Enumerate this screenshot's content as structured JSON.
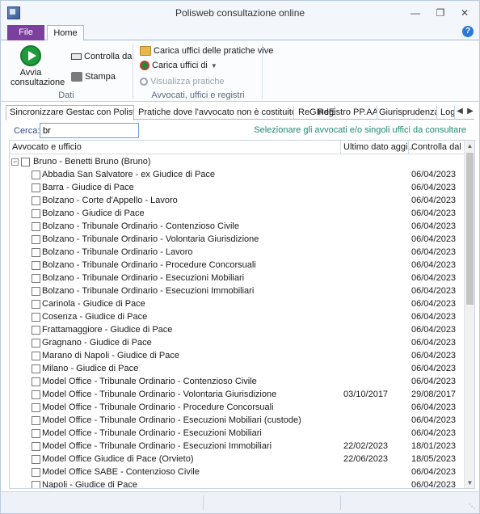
{
  "window": {
    "title": "Polisweb consultazione online"
  },
  "ribbon": {
    "file_tab": "File",
    "home_tab": "Home",
    "groups": {
      "dati": {
        "label": "Dati",
        "avvia_line1": "Avvia",
        "avvia_line2": "consultazione",
        "controlla_dal": "Controlla dal",
        "stampa": "Stampa"
      },
      "avvocati": {
        "label": "Avvocati, uffici e registri",
        "carica_uffici_vive": "Carica uffici delle pratiche vive",
        "carica_uffici_di": "Carica uffici di",
        "visualizza_pratiche": "Visualizza pratiche"
      }
    }
  },
  "content_tabs": [
    "Sincronizzare Gestac con Polisweb",
    "Pratiche dove l'avvocato non è costituito",
    "ReGIndE",
    "Registro PP.AA.",
    "Giurisprudenza",
    "Log"
  ],
  "search": {
    "label": "Cerca:",
    "value": "br",
    "hint": "Selezionare gli avvocati e/o singoli uffici da consultare"
  },
  "grid": {
    "columns": [
      "Avvocato e ufficio",
      "Ultimo dato aggi...",
      "Controlla dal"
    ],
    "group": {
      "label": "Bruno - Benetti Bruno (Bruno)",
      "expander": "−"
    },
    "rows": [
      {
        "name": "Abbadia San Salvatore - ex Giudice di Pace",
        "ultimo": "",
        "dal": "06/04/2023"
      },
      {
        "name": "Barra - Giudice di Pace",
        "ultimo": "",
        "dal": "06/04/2023"
      },
      {
        "name": "Bolzano - Corte d'Appello - Lavoro",
        "ultimo": "",
        "dal": "06/04/2023"
      },
      {
        "name": "Bolzano - Giudice di Pace",
        "ultimo": "",
        "dal": "06/04/2023"
      },
      {
        "name": "Bolzano - Tribunale Ordinario - Contenzioso Civile",
        "ultimo": "",
        "dal": "06/04/2023"
      },
      {
        "name": "Bolzano - Tribunale Ordinario - Volontaria Giurisdizione",
        "ultimo": "",
        "dal": "06/04/2023"
      },
      {
        "name": "Bolzano - Tribunale Ordinario - Lavoro",
        "ultimo": "",
        "dal": "06/04/2023"
      },
      {
        "name": "Bolzano - Tribunale Ordinario - Procedure Concorsuali",
        "ultimo": "",
        "dal": "06/04/2023"
      },
      {
        "name": "Bolzano - Tribunale Ordinario - Esecuzioni Mobiliari",
        "ultimo": "",
        "dal": "06/04/2023"
      },
      {
        "name": "Bolzano - Tribunale Ordinario - Esecuzioni Immobiliari",
        "ultimo": "",
        "dal": "06/04/2023"
      },
      {
        "name": "Carinola - Giudice di Pace",
        "ultimo": "",
        "dal": "06/04/2023"
      },
      {
        "name": "Cosenza - Giudice di Pace",
        "ultimo": "",
        "dal": "06/04/2023"
      },
      {
        "name": "Frattamaggiore - Giudice di Pace",
        "ultimo": "",
        "dal": "06/04/2023"
      },
      {
        "name": "Gragnano - Giudice di Pace",
        "ultimo": "",
        "dal": "06/04/2023"
      },
      {
        "name": "Marano di Napoli - Giudice di Pace",
        "ultimo": "",
        "dal": "06/04/2023"
      },
      {
        "name": "Milano - Giudice di Pace",
        "ultimo": "",
        "dal": "06/04/2023"
      },
      {
        "name": "Model Office - Tribunale Ordinario - Contenzioso Civile",
        "ultimo": "",
        "dal": "06/04/2023"
      },
      {
        "name": "Model Office - Tribunale Ordinario - Volontaria Giurisdizione",
        "ultimo": "03/10/2017",
        "dal": "29/08/2017"
      },
      {
        "name": "Model Office - Tribunale Ordinario - Procedure Concorsuali",
        "ultimo": "",
        "dal": "06/04/2023"
      },
      {
        "name": "Model Office - Tribunale Ordinario - Esecuzioni Mobiliari (custode)",
        "ultimo": "",
        "dal": "06/04/2023"
      },
      {
        "name": "Model Office - Tribunale Ordinario - Esecuzioni Mobiliari",
        "ultimo": "",
        "dal": "06/04/2023"
      },
      {
        "name": "Model Office - Tribunale Ordinario - Esecuzioni Immobiliari",
        "ultimo": "22/02/2023",
        "dal": "18/01/2023"
      },
      {
        "name": "Model Office Giudice di Pace (Orvieto)",
        "ultimo": "22/06/2023",
        "dal": "18/05/2023"
      },
      {
        "name": "Model Office SABE - Contenzioso Civile",
        "ultimo": "",
        "dal": "06/04/2023"
      },
      {
        "name": "Napoli - Giudice di Pace",
        "ultimo": "",
        "dal": "06/04/2023"
      }
    ]
  }
}
